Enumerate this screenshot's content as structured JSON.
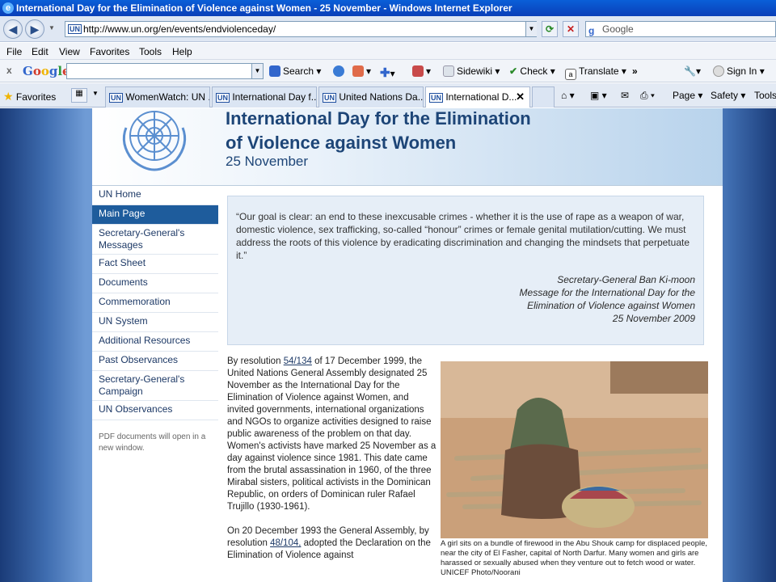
{
  "window": {
    "title": "International Day for the Elimination of Violence against Women - 25 November - Windows Internet Explorer"
  },
  "address_bar": {
    "url": "http://www.un.org/en/events/endviolenceday/",
    "search_placeholder": "Google",
    "site_logo": "UN"
  },
  "menu": [
    "File",
    "Edit",
    "View",
    "Favorites",
    "Tools",
    "Help"
  ],
  "google_toolbar": {
    "logo": "Google",
    "search_label": "Search",
    "sidewiki_label": "Sidewiki",
    "check_label": "Check",
    "translate_label": "Translate",
    "more_label": "»",
    "signin_label": "Sign In"
  },
  "favorites_bar": {
    "favorites_label": "Favorites",
    "tabs": [
      {
        "label": "WomenWatch: UN ..."
      },
      {
        "label": "International Day f..."
      },
      {
        "label": "United Nations Da..."
      },
      {
        "label": "International D..."
      }
    ],
    "commands": {
      "page": "Page",
      "safety": "Safety",
      "tools": "Tools"
    }
  },
  "banner": {
    "title_line1": "International Day for the Elimination",
    "title_line2": "of Violence against Women",
    "date": "25 November"
  },
  "sidebar": {
    "items": [
      {
        "label": "UN Home"
      },
      {
        "label": "Main Page"
      },
      {
        "label": "Secretary-General's Messages"
      },
      {
        "label": "Fact Sheet"
      },
      {
        "label": "Documents"
      },
      {
        "label": "Commemoration"
      },
      {
        "label": "UN System"
      },
      {
        "label": "Additional Resources"
      },
      {
        "label": "Past Observances"
      },
      {
        "label": "Secretary-General's Campaign"
      },
      {
        "label": "UN Observances"
      }
    ],
    "active_index": 1,
    "pdf_note": "PDF documents will open in a new window."
  },
  "quote": {
    "text": "“Our goal is clear: an end to these inexcusable crimes - whether it is the use of rape as a weapon of war, domestic violence, sex trafficking, so-called “honour” crimes or female genital mutilation/cutting. We must address the roots of this violence by eradicating discrimination and changing the mindsets that perpetuate it.”",
    "author": "Secretary-General Ban Ki-moon",
    "source_line1": "Message for the International Day for the",
    "source_line2": "Elimination of Violence against Women",
    "source_date": "25 November 2009"
  },
  "body": {
    "p1_before": "By resolution ",
    "p1_link": "54/134",
    "p1_after": " of 17 December 1999, the United Nations General Assembly designated 25 November as the International Day for the Elimination of Violence against Women, and invited governments, international organizations and NGOs to organize activities designed to raise public awareness of the problem on that day. Women's activists have marked 25 November as a day against violence since 1981. This date came from the brutal assassination in 1960, of the three Mirabal sisters, political activists in the Dominican Republic, on orders of Dominican ruler Rafael Trujillo (1930-1961).",
    "p2_before": "On 20 December 1993 the General Assembly, by resolution ",
    "p2_link": "48/104,",
    "p2_after": " adopted the Declaration on the Elimination of Violence against"
  },
  "photo": {
    "caption": "A girl sits on a bundle of firewood in the Abu Shouk camp for displaced people, near the city of El Fasher, capital of North Darfur. Many women and girls are harassed or sexually abused when they venture out to fetch wood or water.    UNICEF Photo/Noorani"
  },
  "colors": {
    "accent": "#1e5c9c",
    "banner_text": "#1d4577",
    "quote_bg": "#e6eef7"
  }
}
